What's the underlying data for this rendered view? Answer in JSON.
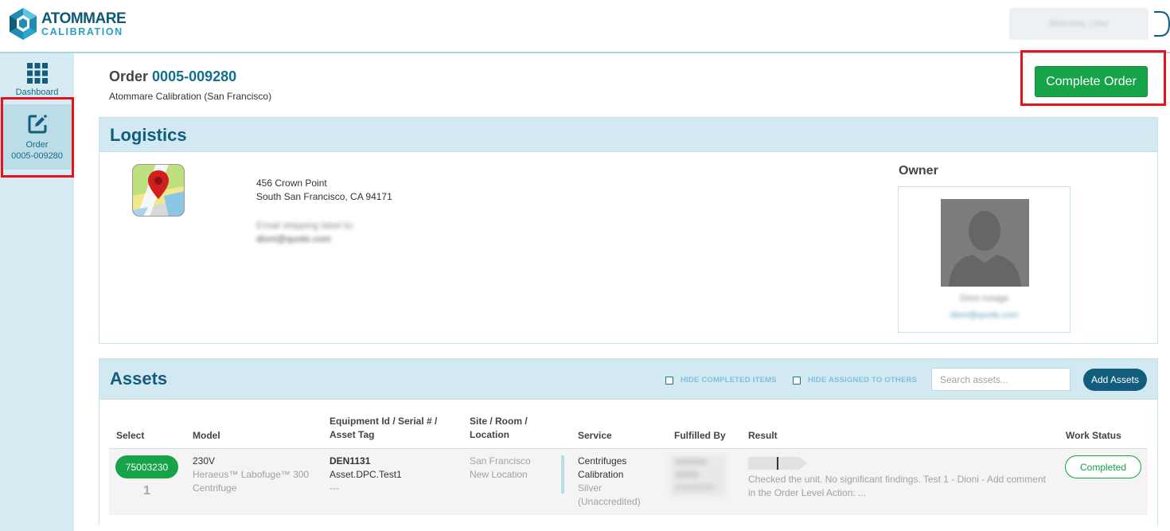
{
  "brand": {
    "line1": "ATOMMARE",
    "line2": "CALIBRATION"
  },
  "header": {
    "user_label": "Welcome, User"
  },
  "sidebar": {
    "dashboard_label": "Dashboard",
    "order_label": "Order",
    "order_number": "0005-009280"
  },
  "order": {
    "title_prefix": "Order",
    "number": "0005-009280",
    "subtitle": "Atommare Calibration (San Francisco)",
    "complete_label": "Complete Order"
  },
  "logistics": {
    "title": "Logistics",
    "address_line1": "456 Crown Point",
    "address_line2": "South San Francisco, CA 94171",
    "email_label": "Email shipping label to:",
    "email_value": "dioni@quote.com",
    "owner_title": "Owner",
    "owner_name": "Dioni Iceage",
    "owner_email": "dioni@quote.com"
  },
  "assets": {
    "title": "Assets",
    "hide_completed_label": "HIDE COMPLETED ITEMS",
    "hide_assigned_label": "HIDE ASSIGNED TO OTHERS",
    "search_placeholder": "Search assets...",
    "add_label": "Add Assets",
    "columns": {
      "select": "Select",
      "model": "Model",
      "equip_line1": "Equipment Id / Serial # /",
      "equip_line2": "Asset Tag",
      "site_line1": "Site / Room /",
      "site_line2": "Location",
      "service": "Service",
      "fulfilled": "Fulfilled By",
      "result": "Result",
      "status": "Work Status"
    },
    "rows": [
      {
        "select_id": "75003230",
        "row_number": "1",
        "model_line1": "230V",
        "model_line2": "Heraeus™ Labofuge™ 300",
        "model_line3": "Centrifuge",
        "equip_id": "DEN1131",
        "equip_serial": "Asset.DPC.Test1",
        "equip_tag": "---",
        "site": "San Francisco",
        "location": "New Location",
        "service_line1": "Centrifuges",
        "service_line2": "Calibration",
        "service_line3": "Silver",
        "service_line4": "(Unaccredited)",
        "result_line1": "Checked the unit. No significant findings. Test 1 - Dioni - Add comment",
        "result_line2": "in the Order Level Action: ...",
        "status": "Completed"
      }
    ]
  }
}
